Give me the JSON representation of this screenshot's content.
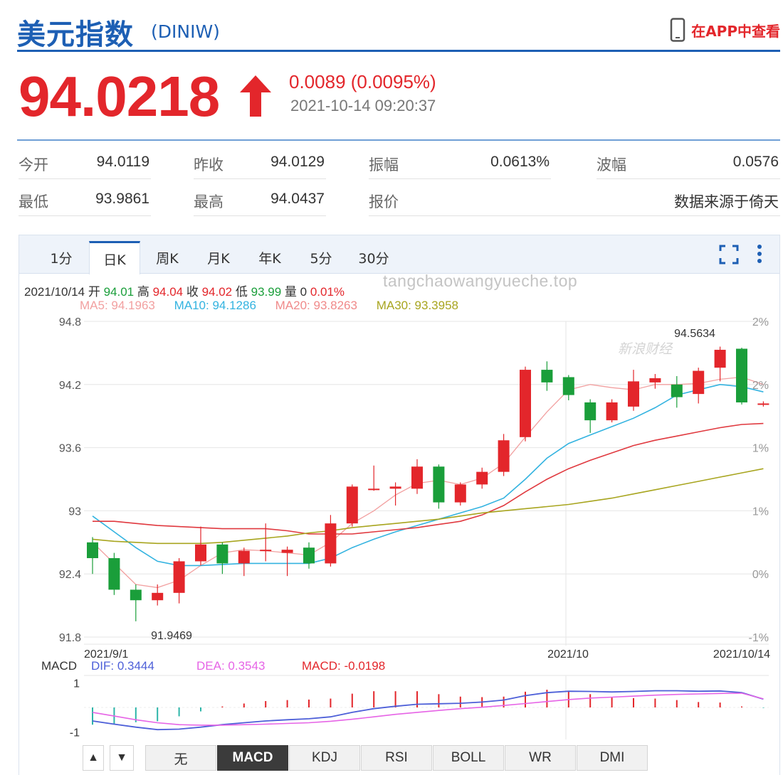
{
  "header": {
    "title": "美元指数",
    "code": "(DINIW)",
    "app_link": "在APP中查看",
    "phone_icon": "phone-icon"
  },
  "quote": {
    "price": "94.0218",
    "arrow_icon": "up-arrow-icon",
    "change": "0.0089 (0.0095%)",
    "timestamp": "2021-10-14 09:20:37"
  },
  "stats": {
    "open_label": "今开",
    "open_value": "94.0119",
    "prev_close_label": "昨收",
    "prev_close_value": "94.0129",
    "amplitude_label": "振幅",
    "amplitude_value": "0.0613%",
    "wave_label": "波幅",
    "wave_value": "0.0576",
    "low_label": "最低",
    "low_value": "93.9861",
    "high_label": "最高",
    "high_value": "94.0437",
    "quote_label": "报价",
    "source": "数据来源于倚天"
  },
  "tabs": [
    "1分",
    "日K",
    "周K",
    "月K",
    "年K",
    "5分",
    "30分"
  ],
  "active_tab": "日K",
  "tools": {
    "fullscreen_icon": "fullscreen-icon",
    "more_icon": "more-vertical-icon"
  },
  "ohlc": {
    "date": "2021/10/14",
    "open_label": "开",
    "open": "94.01",
    "high_label": "高",
    "high": "94.04",
    "close_label": "收",
    "close": "94.02",
    "low_label": "低",
    "low": "93.99",
    "vol_label": "量",
    "vol": "0",
    "pct": "0.01%"
  },
  "ma": {
    "ma5": "MA5: 94.1963",
    "ma10": "MA10: 94.1286",
    "ma20": "MA20: 93.8263",
    "ma30": "MA30: 93.3958"
  },
  "watermark": "tangchaowangyueche.top",
  "logo_text": "新浪财经",
  "colors": {
    "up": "#e3262b",
    "down": "#1a9e3a",
    "ma5": "#f2a0a0",
    "ma10": "#33b3e0",
    "ma20": "#e0393f",
    "ma30": "#a8a51f",
    "dif": "#4d5fd8",
    "dea": "#e664e6",
    "macd": "#e3262b"
  },
  "chart_data": {
    "type": "candlestick",
    "y_ticks": [
      "94.8",
      "94.2",
      "93.6",
      "93",
      "92.4",
      "91.8"
    ],
    "y_range": [
      91.8,
      94.8
    ],
    "pct_ticks": [
      "2%",
      "2%",
      "1%",
      "1%",
      "0%",
      "-1%"
    ],
    "x_labels": [
      "2021/9/1",
      "2021/10",
      "2021/10/14"
    ],
    "annotations": {
      "max": "94.5634",
      "min": "91.9469"
    },
    "candles": [
      [
        92.7,
        92.55,
        92.75,
        92.4
      ],
      [
        92.55,
        92.25,
        92.6,
        92.2
      ],
      [
        92.25,
        92.15,
        92.3,
        91.95
      ],
      [
        92.15,
        92.22,
        92.3,
        92.1
      ],
      [
        92.22,
        92.52,
        92.55,
        92.12
      ],
      [
        92.52,
        92.68,
        92.85,
        92.48
      ],
      [
        92.68,
        92.5,
        92.7,
        92.4
      ],
      [
        92.5,
        92.62,
        92.65,
        92.38
      ],
      [
        92.62,
        92.63,
        92.88,
        92.52
      ],
      [
        92.6,
        92.63,
        92.66,
        92.38
      ],
      [
        92.65,
        92.5,
        92.7,
        92.45
      ],
      [
        92.5,
        92.88,
        92.96,
        92.47
      ],
      [
        92.88,
        93.23,
        93.25,
        92.85
      ],
      [
        93.2,
        93.21,
        93.43,
        93.19
      ],
      [
        93.21,
        93.23,
        93.27,
        93.05
      ],
      [
        93.21,
        93.42,
        93.49,
        93.16
      ],
      [
        93.42,
        93.08,
        93.44,
        93.02
      ],
      [
        93.08,
        93.25,
        93.27,
        93.05
      ],
      [
        93.25,
        93.37,
        93.41,
        93.21
      ],
      [
        93.37,
        93.67,
        93.73,
        93.33
      ],
      [
        93.7,
        94.34,
        94.37,
        93.66
      ],
      [
        94.34,
        94.22,
        94.42,
        94.14
      ],
      [
        94.27,
        94.1,
        94.29,
        94.05
      ],
      [
        94.03,
        93.86,
        94.06,
        93.74
      ],
      [
        93.86,
        94.03,
        94.06,
        93.84
      ],
      [
        93.99,
        94.23,
        94.34,
        93.95
      ],
      [
        94.22,
        94.26,
        94.3,
        94.16
      ],
      [
        94.2,
        94.08,
        94.28,
        93.98
      ],
      [
        94.11,
        94.33,
        94.36,
        94.02
      ],
      [
        94.36,
        94.53,
        94.56,
        94.23
      ],
      [
        94.54,
        94.03,
        94.55,
        94.01
      ],
      [
        94.01,
        94.02,
        94.04,
        93.99
      ]
    ],
    "ma_series": {
      "ma5": [
        92.7,
        92.5,
        92.3,
        92.27,
        92.34,
        92.48,
        92.6,
        92.63,
        92.62,
        92.6,
        92.58,
        92.7,
        92.88,
        93.0,
        93.15,
        93.26,
        93.29,
        93.25,
        93.31,
        93.45,
        93.7,
        93.94,
        94.15,
        94.2,
        94.17,
        94.15,
        94.2,
        94.2,
        94.21,
        94.25,
        94.27,
        94.2
      ],
      "ma10": [
        92.95,
        92.8,
        92.65,
        92.52,
        92.48,
        92.48,
        92.49,
        92.5,
        92.5,
        92.5,
        92.5,
        92.55,
        92.65,
        92.73,
        92.8,
        92.86,
        92.92,
        92.98,
        93.04,
        93.12,
        93.3,
        93.5,
        93.64,
        93.72,
        93.8,
        93.88,
        93.98,
        94.1,
        94.15,
        94.2,
        94.18,
        94.13
      ],
      "ma20": [
        92.9,
        92.9,
        92.88,
        92.86,
        92.85,
        92.84,
        92.83,
        92.83,
        92.83,
        92.81,
        92.78,
        92.78,
        92.78,
        92.8,
        92.82,
        92.84,
        92.87,
        92.9,
        92.96,
        93.05,
        93.18,
        93.3,
        93.4,
        93.48,
        93.55,
        93.62,
        93.67,
        93.71,
        93.75,
        93.79,
        93.82,
        93.83
      ],
      "ma30": [
        92.73,
        92.71,
        92.7,
        92.69,
        92.69,
        92.69,
        92.7,
        92.72,
        92.74,
        92.76,
        92.79,
        92.81,
        92.84,
        92.86,
        92.88,
        92.9,
        92.92,
        92.95,
        92.98,
        93.0,
        93.02,
        93.04,
        93.06,
        93.09,
        93.12,
        93.16,
        93.2,
        93.24,
        93.28,
        93.32,
        93.36,
        93.4
      ]
    },
    "macd_label": "MACD",
    "dif_label": "DIF: 0.3444",
    "dea_label": "DEA: 0.3543",
    "macd_value_label": "MACD: -0.0198",
    "macd_ticks": [
      "1",
      "-1"
    ],
    "macd_range": [
      -1.3,
      1.3
    ],
    "dif": [
      -0.55,
      -0.68,
      -0.8,
      -0.9,
      -0.88,
      -0.8,
      -0.7,
      -0.62,
      -0.55,
      -0.5,
      -0.46,
      -0.38,
      -0.2,
      -0.05,
      0.05,
      0.13,
      0.15,
      0.17,
      0.22,
      0.3,
      0.48,
      0.6,
      0.66,
      0.65,
      0.63,
      0.65,
      0.68,
      0.68,
      0.66,
      0.67,
      0.6,
      0.34
    ],
    "dea": [
      -0.2,
      -0.35,
      -0.5,
      -0.62,
      -0.7,
      -0.72,
      -0.72,
      -0.7,
      -0.68,
      -0.65,
      -0.62,
      -0.56,
      -0.48,
      -0.38,
      -0.28,
      -0.2,
      -0.12,
      -0.05,
      0.01,
      0.08,
      0.16,
      0.24,
      0.32,
      0.38,
      0.42,
      0.46,
      0.5,
      0.53,
      0.55,
      0.57,
      0.58,
      0.35
    ],
    "macd_hist": [
      -0.7,
      -0.66,
      -0.6,
      -0.56,
      -0.36,
      -0.16,
      0.04,
      0.16,
      0.26,
      0.3,
      0.32,
      0.36,
      0.56,
      0.66,
      0.66,
      0.66,
      0.54,
      0.44,
      0.42,
      0.44,
      0.64,
      0.72,
      0.68,
      0.54,
      0.42,
      0.38,
      0.36,
      0.3,
      0.22,
      0.2,
      0.04,
      -0.02
    ]
  },
  "indicators": [
    "无",
    "MACD",
    "KDJ",
    "RSI",
    "BOLL",
    "WR",
    "DMI"
  ],
  "active_indicator": "MACD",
  "scroll_arrows": {
    "up": "▲",
    "down": "▼"
  }
}
